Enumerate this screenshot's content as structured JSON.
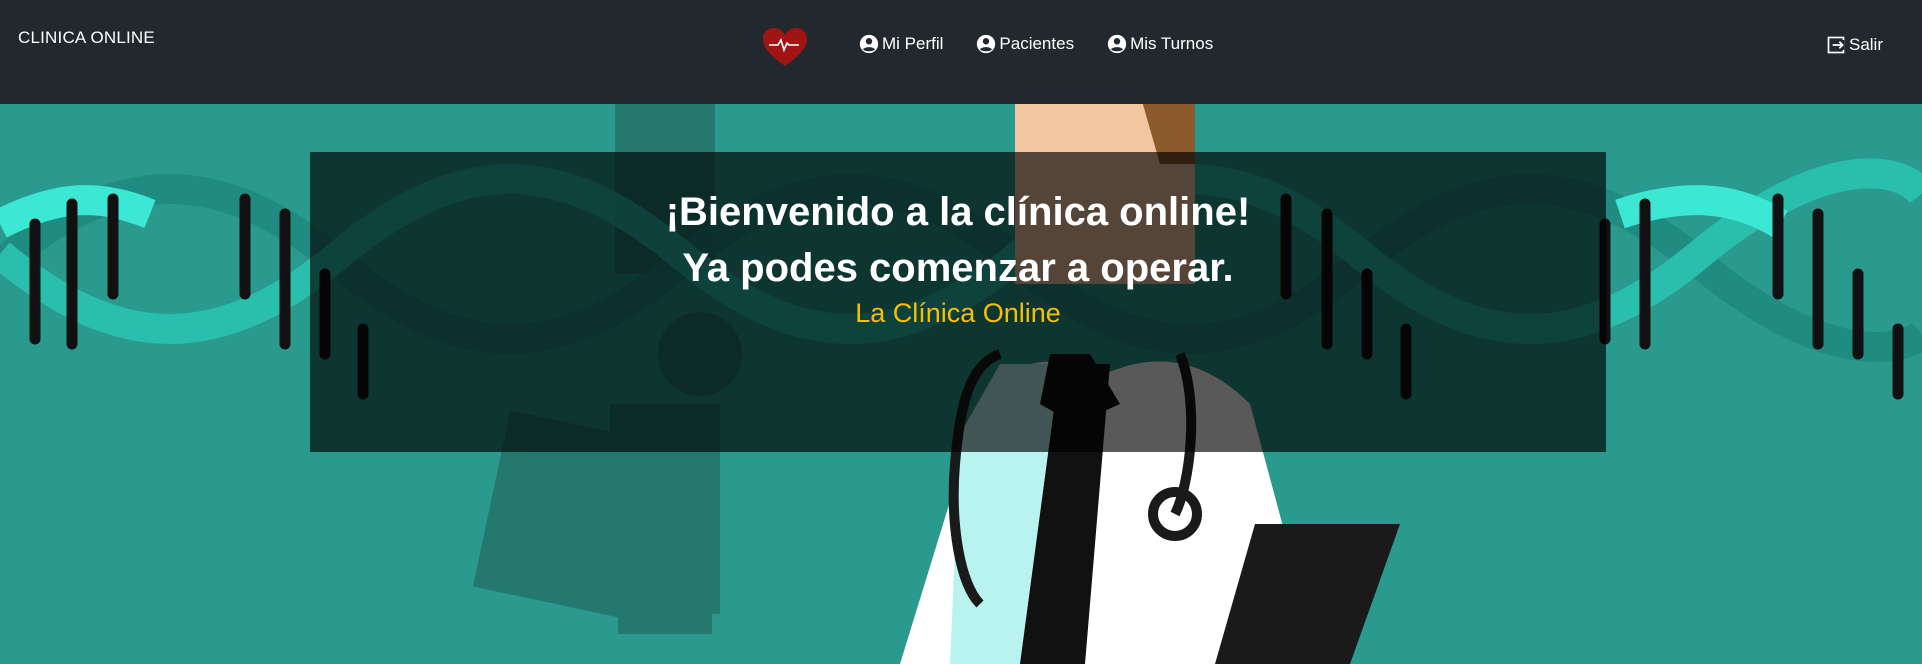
{
  "navbar": {
    "brand": "CLINICA ONLINE",
    "logo_icon": "heart-pulse-icon",
    "items": [
      {
        "label": "Mi Perfil",
        "icon": "account-circle-icon"
      },
      {
        "label": "Pacientes",
        "icon": "account-circle-icon"
      },
      {
        "label": "Mis Turnos",
        "icon": "account-circle-icon"
      }
    ],
    "logout": {
      "label": "Salir",
      "icon": "logout-icon"
    }
  },
  "hero": {
    "title_line1": "¡Bienvenido a la clínica online!",
    "title_line2": "Ya podes comenzar a operar.",
    "subtitle": "La Clínica Online",
    "colors": {
      "background": "#2a9a8e",
      "navbar": "#22292e",
      "subtitle": "#f5c000",
      "heart": "#a01414"
    }
  }
}
